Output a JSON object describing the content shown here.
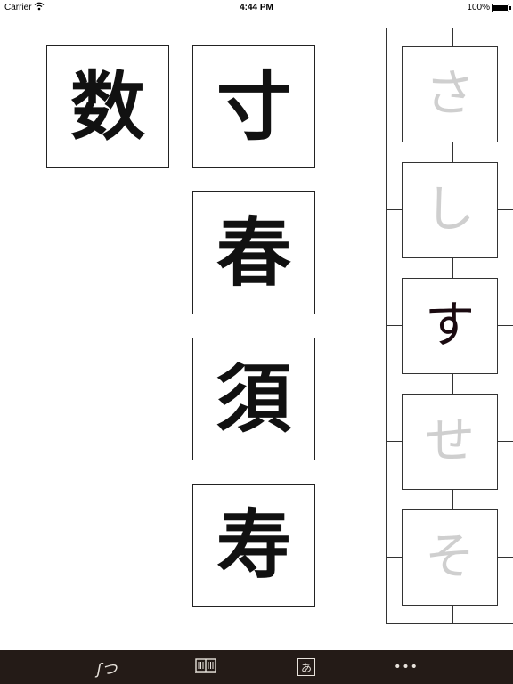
{
  "status_bar": {
    "carrier": "Carrier",
    "time": "4:44 PM",
    "battery": "100%"
  },
  "characters": {
    "left_kanji": "数",
    "column_kanji": [
      "寸",
      "春",
      "須",
      "寿"
    ]
  },
  "kana_strip": {
    "items": [
      "さ",
      "し",
      "す",
      "せ",
      "そ"
    ],
    "selected": "す"
  },
  "tab_bar": {
    "brush_glyph": "ʃつ",
    "kana_tab_glyph": "あ",
    "more_glyph": "•••"
  }
}
